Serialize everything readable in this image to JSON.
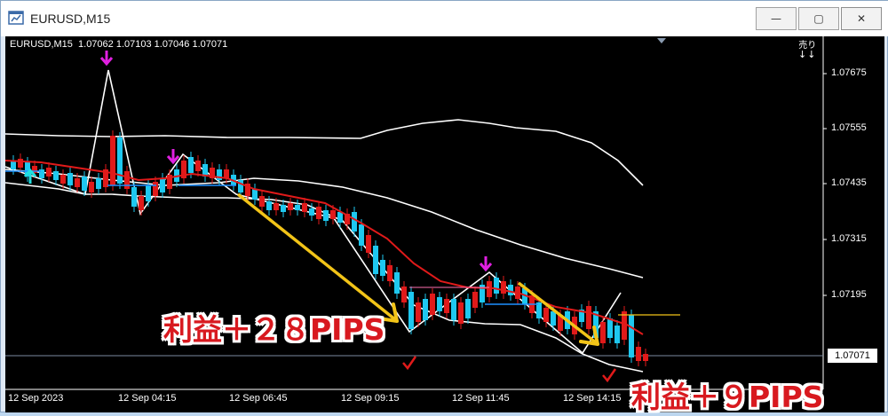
{
  "window": {
    "title": "EURUSD,M15",
    "minimize_glyph": "—",
    "maximize_glyph": "▢",
    "close_glyph": "✕"
  },
  "chart": {
    "symbol_info": "EURUSD,M15  1.07062 1.07103 1.07046 1.07071",
    "sell_label": "売り",
    "sell_arrows": "↓↓",
    "current_price": "1.07071",
    "y_ticks": [
      "1.07675",
      "1.07555",
      "1.07435",
      "1.07315",
      "1.07195"
    ],
    "x_ticks": [
      "12 Sep 2023",
      "12 Sep 04:15",
      "12 Sep 06:45",
      "12 Sep 09:15",
      "12 Sep 11:45",
      "12 Sep 14:15"
    ],
    "colors": {
      "background": "#000000",
      "bull": "#1ec8f0",
      "bear": "#e01a1a",
      "ma": "#e01a1a",
      "band": "#ffffff",
      "zigzag": "#ffffff",
      "annotation_arrow": "#f2c418",
      "signal_arrow_sell": "#e020e0",
      "signal_arrow_buy": "#20e0e0"
    }
  },
  "annotations": {
    "profit1": "利益＋２８PIPS",
    "profit2": "利益＋９PIPS"
  }
}
